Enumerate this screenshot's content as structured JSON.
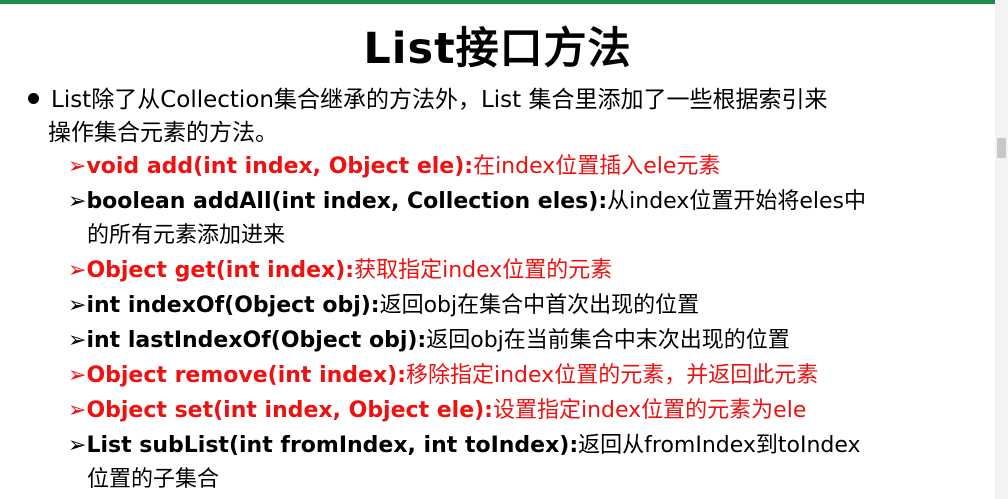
{
  "title": "List接口方法",
  "intro": {
    "line1": "List除了从Collection集合继承的方法外，List 集合里添加了一些根据索引来",
    "line2": "操作集合元素的方法。"
  },
  "methods": [
    {
      "sig": "void add(int index, Object ele):",
      "desc": "在index位置插入ele元素",
      "cont": "",
      "red": true
    },
    {
      "sig": "boolean addAll(int index, Collection eles):",
      "desc": "从index位置开始将eles中",
      "cont": "的所有元素添加进来",
      "red": false
    },
    {
      "sig": "Object get(int index):",
      "desc": "获取指定index位置的元素",
      "cont": "",
      "red": true
    },
    {
      "sig": "int indexOf(Object obj):",
      "desc": "返回obj在集合中首次出现的位置",
      "cont": "",
      "red": false
    },
    {
      "sig": "int lastIndexOf(Object obj):",
      "desc": "返回obj在当前集合中末次出现的位置",
      "cont": "",
      "red": false
    },
    {
      "sig": "Object remove(int index):",
      "desc": "移除指定index位置的元素，并返回此元素",
      "cont": "",
      "red": true
    },
    {
      "sig": "Object set(int index, Object ele):",
      "desc": "设置指定index位置的元素为ele",
      "cont": "",
      "red": true
    },
    {
      "sig": "List subList(int fromIndex, int toIndex):",
      "desc": "返回从fromIndex到toIndex",
      "cont": "位置的子集合",
      "red": false
    }
  ],
  "icons": {
    "bullet": "bullet-dot",
    "arrow": "➢"
  },
  "colors": {
    "highlight": "#ee1111",
    "rule": "#1f8a4c",
    "text": "#000000"
  }
}
